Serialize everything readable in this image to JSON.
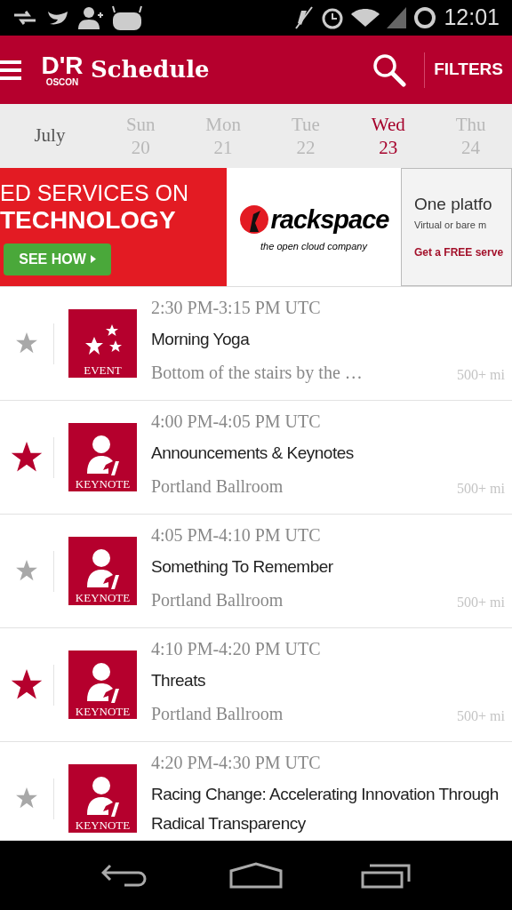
{
  "status_bar": {
    "time": "12:01"
  },
  "app_bar": {
    "title": "Schedule",
    "logo_mark": "D'R",
    "logo_text": "OSCON",
    "filters": "FILTERS"
  },
  "date_bar": {
    "month": "July",
    "days": [
      {
        "weekday": "Sun",
        "date": "20",
        "selected": false
      },
      {
        "weekday": "Mon",
        "date": "21",
        "selected": false
      },
      {
        "weekday": "Tue",
        "date": "22",
        "selected": false
      },
      {
        "weekday": "Wed",
        "date": "23",
        "selected": true
      },
      {
        "weekday": "Thu",
        "date": "24",
        "selected": false
      }
    ]
  },
  "ad_banner": {
    "headline_1": "ED SERVICES ON",
    "headline_2": "TECHNOLOGY",
    "cta": "SEE HOW",
    "brand": "rackspace",
    "tagline": "the open cloud company",
    "side_title": "One platfo",
    "side_text": "Virtual or bare m",
    "side_cta": "Get a FREE serve"
  },
  "sessions": [
    {
      "starred": false,
      "kind": "event",
      "badge": "EVENT",
      "time": "2:30 PM-3:15 PM UTC",
      "title": "Morning Yoga",
      "location": "Bottom of the stairs by the …",
      "distance": "500+ mi"
    },
    {
      "starred": true,
      "kind": "keynote",
      "badge": "KEYNOTE",
      "time": "4:00 PM-4:05 PM UTC",
      "title": "Announcements & Keynotes",
      "location": "Portland Ballroom",
      "distance": "500+ mi"
    },
    {
      "starred": false,
      "kind": "keynote",
      "badge": "KEYNOTE",
      "time": "4:05 PM-4:10 PM UTC",
      "title": "Something To Remember",
      "location": "Portland Ballroom",
      "distance": "500+ mi"
    },
    {
      "starred": true,
      "kind": "keynote",
      "badge": "KEYNOTE",
      "time": "4:10 PM-4:20 PM UTC",
      "title": "Threats",
      "location": "Portland Ballroom",
      "distance": "500+ mi"
    },
    {
      "starred": false,
      "kind": "keynote",
      "badge": "KEYNOTE",
      "time": "4:20 PM-4:30 PM UTC",
      "title": "Racing Change: Accelerating Innovation Through Radical Transparency"
    }
  ]
}
